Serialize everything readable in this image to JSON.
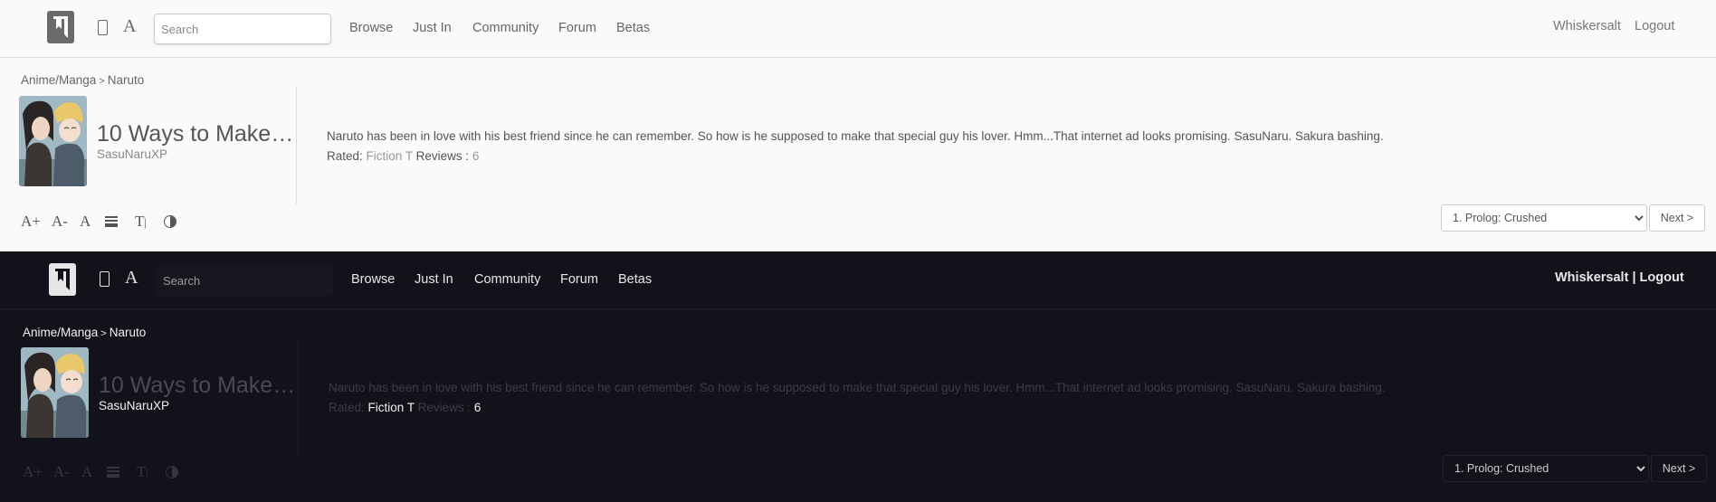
{
  "light": {
    "search": {
      "placeholder": "Search"
    },
    "nav": [
      "Browse",
      "Just In",
      "Community",
      "Forum",
      "Betas"
    ],
    "user": {
      "name": "Whiskersalt",
      "logout": "Logout",
      "separator": ""
    },
    "breadcrumb": {
      "category": "Anime/Manga",
      "sep": ">",
      "fandom": "Naruto"
    },
    "story": {
      "title": "10 Ways to Make…",
      "author": "SasuNaruXP",
      "summary": "Naruto has been in love with his best friend since he can remember. So how is he supposed to make that special guy his lover. Hmm...That internet ad looks promising. SasuNaru. Sakura bashing.",
      "rated_label": "Rated:",
      "rating": "Fiction T",
      "reviews_label": "Reviews :",
      "reviews": "6"
    },
    "tools": {
      "font_up": "A+",
      "font_down": "A-",
      "font": "A",
      "text_size": "T"
    },
    "chapter": {
      "selected": "1. Prolog: Crushed",
      "next": "Next >"
    }
  },
  "dark": {
    "search": {
      "placeholder": "Search"
    },
    "nav": [
      "Browse",
      "Just In",
      "Community",
      "Forum",
      "Betas"
    ],
    "user": {
      "name": "Whiskersalt",
      "logout": "Logout",
      "separator": "|"
    },
    "breadcrumb": {
      "category": "Anime/Manga",
      "sep": ">",
      "fandom": "Naruto"
    },
    "story": {
      "title": "10 Ways to Make…",
      "author": "SasuNaruXP",
      "summary": "Naruto has been in love with his best friend since he can remember. So how is he supposed to make that special guy his lover. Hmm...That internet ad looks promising. SasuNaru. Sakura bashing.",
      "rated_label": "Rated:",
      "rating": "Fiction T",
      "reviews_label": "Reviews :",
      "reviews": "6"
    },
    "tools": {
      "font_up": "A+",
      "font_down": "A-",
      "font": "A",
      "text_size": "T"
    },
    "chapter": {
      "selected": "1. Prolog: Crushed",
      "next": "Next >"
    }
  }
}
